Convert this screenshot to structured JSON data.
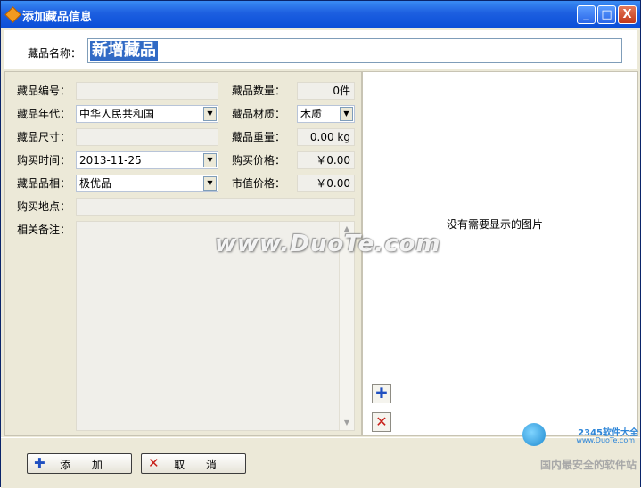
{
  "window": {
    "title": "添加藏品信息",
    "minimize": "_",
    "maximize": "□",
    "close": "X"
  },
  "name_row": {
    "label": "藏品名称：",
    "value": "新增藏品"
  },
  "form": {
    "code_label": "藏品编号：",
    "code_value": "",
    "quantity_label": "藏品数量：",
    "quantity_value": "0件",
    "era_label": "藏品年代：",
    "era_value": "中华人民共和国",
    "material_label": "藏品材质：",
    "material_value": "木质",
    "size_label": "藏品尺寸：",
    "size_value": "",
    "weight_label": "藏品重量：",
    "weight_value": "0.00 kg",
    "buy_time_label": "购买时间：",
    "buy_time_value": "2013-11-25",
    "buy_price_label": "购买价格：",
    "buy_price_value": "￥0.00",
    "condition_label": "藏品品相：",
    "condition_value": "极优品",
    "market_price_label": "市值价格：",
    "market_price_value": "￥0.00",
    "buy_place_label": "购买地点：",
    "buy_place_value": "",
    "notes_label": "相关备注：",
    "notes_value": ""
  },
  "image_panel": {
    "empty_text": "没有需要显示的图片"
  },
  "buttons": {
    "add_label": "添 加",
    "cancel_label": "取 消"
  },
  "watermark": {
    "text": "www.DuoTe.com"
  },
  "logo": {
    "brand": "2345软件大全",
    "site": "www.DuoTe.com",
    "slogan": "国内最安全的软件站"
  },
  "icons": {
    "title": "diamond-icon",
    "add": "plus-icon",
    "delete": "x-icon",
    "dropdown": "chevron-down-icon"
  },
  "colors": {
    "titlebar": "#1d5fe0",
    "selection": "#316ac5",
    "add_icon": "#1f4fc0",
    "delete_icon": "#c8201a"
  }
}
